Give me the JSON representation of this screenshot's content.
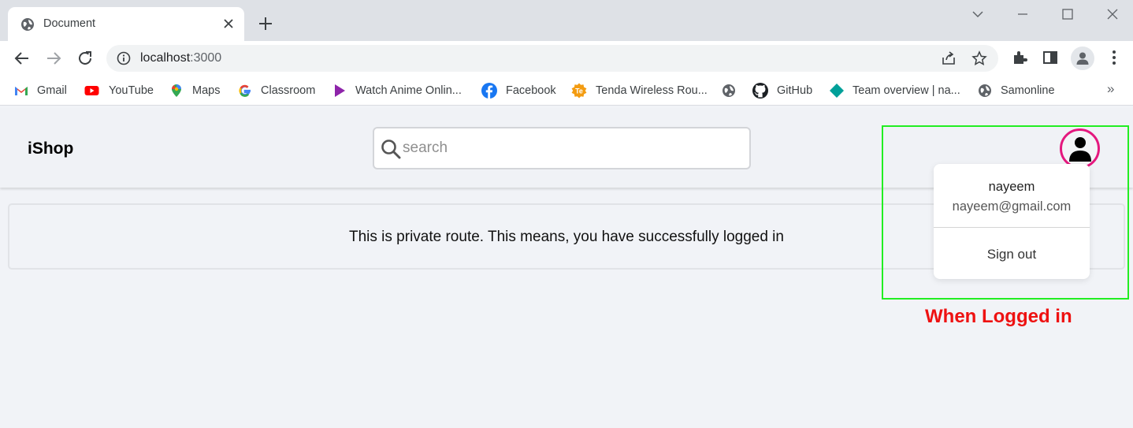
{
  "browser": {
    "tab_title": "Document",
    "url_host": "localhost",
    "url_port": ":3000",
    "bookmarks": [
      {
        "label": "Gmail",
        "icon": "gmail-icon"
      },
      {
        "label": "YouTube",
        "icon": "youtube-icon"
      },
      {
        "label": "Maps",
        "icon": "maps-icon"
      },
      {
        "label": "Classroom",
        "icon": "google-icon"
      },
      {
        "label": "Watch Anime Onlin...",
        "icon": "play-icon"
      },
      {
        "label": "Facebook",
        "icon": "facebook-icon"
      },
      {
        "label": "Tenda Wireless Rou...",
        "icon": "tenda-icon"
      },
      {
        "label": "",
        "icon": "globe-icon"
      },
      {
        "label": "GitHub",
        "icon": "github-icon"
      },
      {
        "label": "Team overview | na...",
        "icon": "diamond-icon"
      },
      {
        "label": "Samonline",
        "icon": "globe-icon"
      }
    ],
    "more_label": "»"
  },
  "app": {
    "brand": "iShop",
    "search_placeholder": "search",
    "message": "This is private route. This means, you have successfully logged in"
  },
  "user_menu": {
    "name": "nayeem",
    "email": "nayeem@gmail.com",
    "signout_label": "Sign out"
  },
  "annotation": {
    "text": "When Logged in",
    "box_color": "#22ee22",
    "text_color": "#ee1111",
    "avatar_ring_color": "#e4187e"
  }
}
